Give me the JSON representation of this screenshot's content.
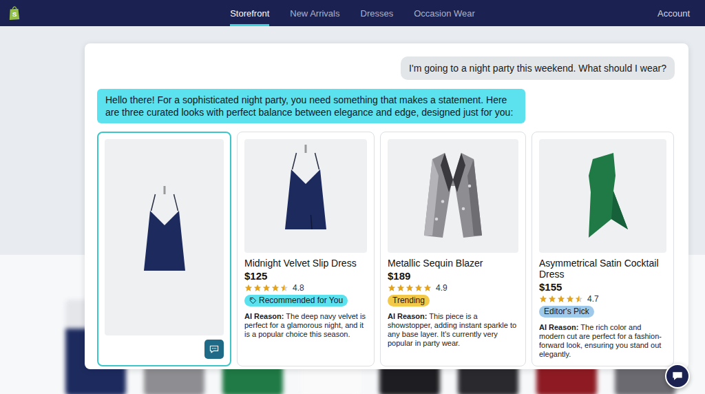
{
  "nav": {
    "logo_letter": "S",
    "items": [
      {
        "label": "Storefront",
        "selected": true
      },
      {
        "label": "New Arrivals",
        "selected": false
      },
      {
        "label": "Dresses",
        "selected": false
      },
      {
        "label": "Occasion Wear",
        "selected": false
      }
    ],
    "account": "Account"
  },
  "chat": {
    "user_message": "I'm going to a night party this weekend. What should I wear?",
    "assistant_message": "Hello there! For a sophisticated night party, you need something that makes a statement. Here are three curated looks with perfect balance between elegance and edge, designed just for you:"
  },
  "cards": [
    {
      "kind": "preview",
      "image": "slip-dress",
      "selected": true
    },
    {
      "kind": "product",
      "image": "slip-dress",
      "selected": false,
      "name": "Midnight Velvet Slip Dress",
      "price": "$125",
      "stars": 4.5,
      "rating": "4.8",
      "badge": {
        "label": "Recommended for You",
        "color": "#5ce1ee",
        "icon": true
      },
      "reason_label": "AI Reason:",
      "reason": "The deep navy velvet is perfect for a glamorous night, and it is a popular choice this season."
    },
    {
      "kind": "product",
      "image": "blazer",
      "selected": false,
      "name": "Metallic Sequin Blazer",
      "price": "$189",
      "stars": 5,
      "rating": "4.9",
      "badge": {
        "label": "Trending",
        "color": "#f3c94a",
        "icon": false
      },
      "reason_label": "AI Reason:",
      "reason": "This piece is a showstopper, adding instant sparkle to any base layer. It's currently very popular in party wear."
    },
    {
      "kind": "product",
      "image": "satin-dress",
      "selected": false,
      "name": "Asymmetrical Satin Cocktail Dress",
      "price": "$155",
      "stars": 4.5,
      "rating": "4.7",
      "badge": {
        "label": "Editor's Pick",
        "color": "#9fc9ea",
        "icon": false
      },
      "reason_label": "AI Reason:",
      "reason": "The rich color and modern cut are perfect for a fashion-forward look, ensuring you stand out elegantly."
    }
  ]
}
